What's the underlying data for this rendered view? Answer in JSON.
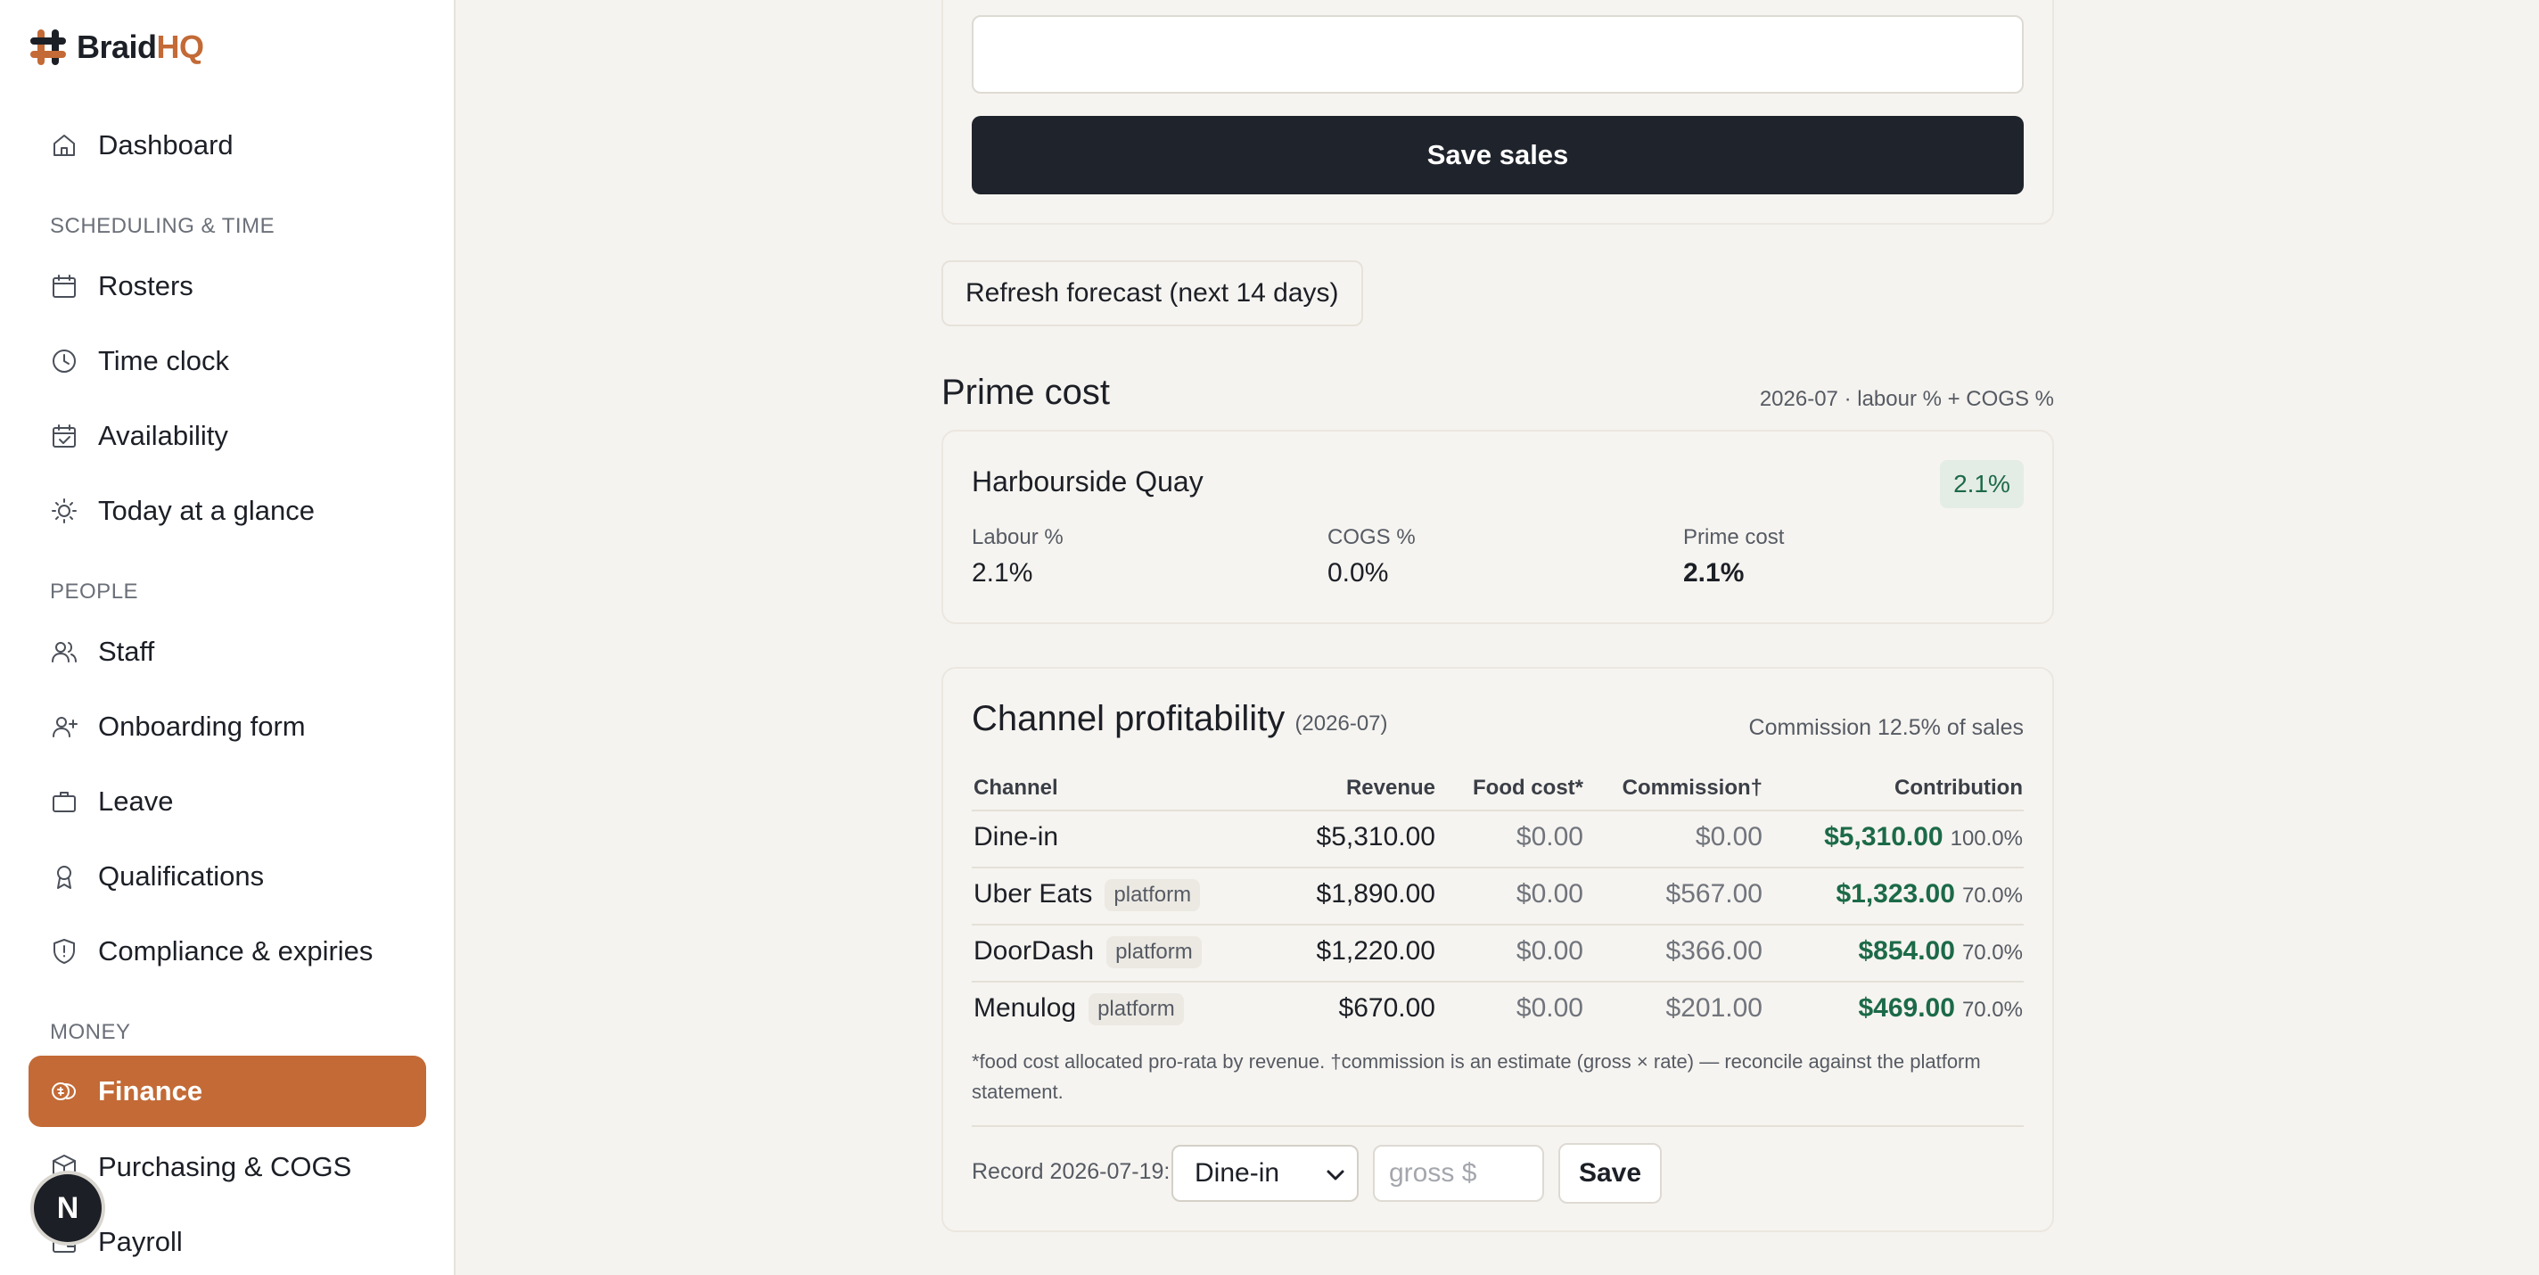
{
  "app": {
    "brand_prefix": "Braid",
    "brand_suffix": "HQ",
    "brand_color": "#c36a36"
  },
  "sidebar": {
    "dashboard": "Dashboard",
    "section_scheduling": "SCHEDULING & TIME",
    "rosters": "Rosters",
    "time_clock": "Time clock",
    "availability": "Availability",
    "today": "Today at a glance",
    "section_people": "PEOPLE",
    "staff": "Staff",
    "onboarding": "Onboarding form",
    "leave": "Leave",
    "qualifications": "Qualifications",
    "compliance": "Compliance & expiries",
    "section_money": "MONEY",
    "finance": "Finance",
    "purchasing": "Purchasing & COGS",
    "payroll": "Payroll",
    "avatar_letter": "N"
  },
  "sales_form": {
    "save_label": "Save sales"
  },
  "forecast": {
    "refresh_label": "Refresh forecast (next 14 days)"
  },
  "prime_cost": {
    "title": "Prime cost",
    "meta": "2026-07 · labour % + COGS %",
    "location": "Harbourside Quay",
    "badge": "2.1%",
    "labour_label": "Labour %",
    "labour_value": "2.1%",
    "cogs_label": "COGS %",
    "cogs_value": "0.0%",
    "prime_label": "Prime cost",
    "prime_value": "2.1%"
  },
  "channels": {
    "title": "Channel profitability",
    "period": "(2026-07)",
    "commission_note": "Commission 12.5% of sales",
    "headers": [
      "Channel",
      "Revenue",
      "Food cost*",
      "Commission†",
      "Contribution"
    ],
    "rows": [
      {
        "channel": "Dine-in",
        "tag": "",
        "revenue": "$5,310.00",
        "food": "$0.00",
        "commission": "$0.00",
        "contribution": "$5,310.00",
        "pct": "100.0%"
      },
      {
        "channel": "Uber Eats",
        "tag": "platform",
        "revenue": "$1,890.00",
        "food": "$0.00",
        "commission": "$567.00",
        "contribution": "$1,323.00",
        "pct": "70.0%"
      },
      {
        "channel": "DoorDash",
        "tag": "platform",
        "revenue": "$1,220.00",
        "food": "$0.00",
        "commission": "$366.00",
        "contribution": "$854.00",
        "pct": "70.0%"
      },
      {
        "channel": "Menulog",
        "tag": "platform",
        "revenue": "$670.00",
        "food": "$0.00",
        "commission": "$201.00",
        "contribution": "$469.00",
        "pct": "70.0%"
      }
    ],
    "footnote": "*food cost allocated pro-rata by revenue. †commission is an estimate (gross × rate) — reconcile against the platform statement.",
    "record_label": "Record 2026-07-19:",
    "select_value": "Dine-in",
    "gross_placeholder": "gross $",
    "save_label": "Save"
  }
}
